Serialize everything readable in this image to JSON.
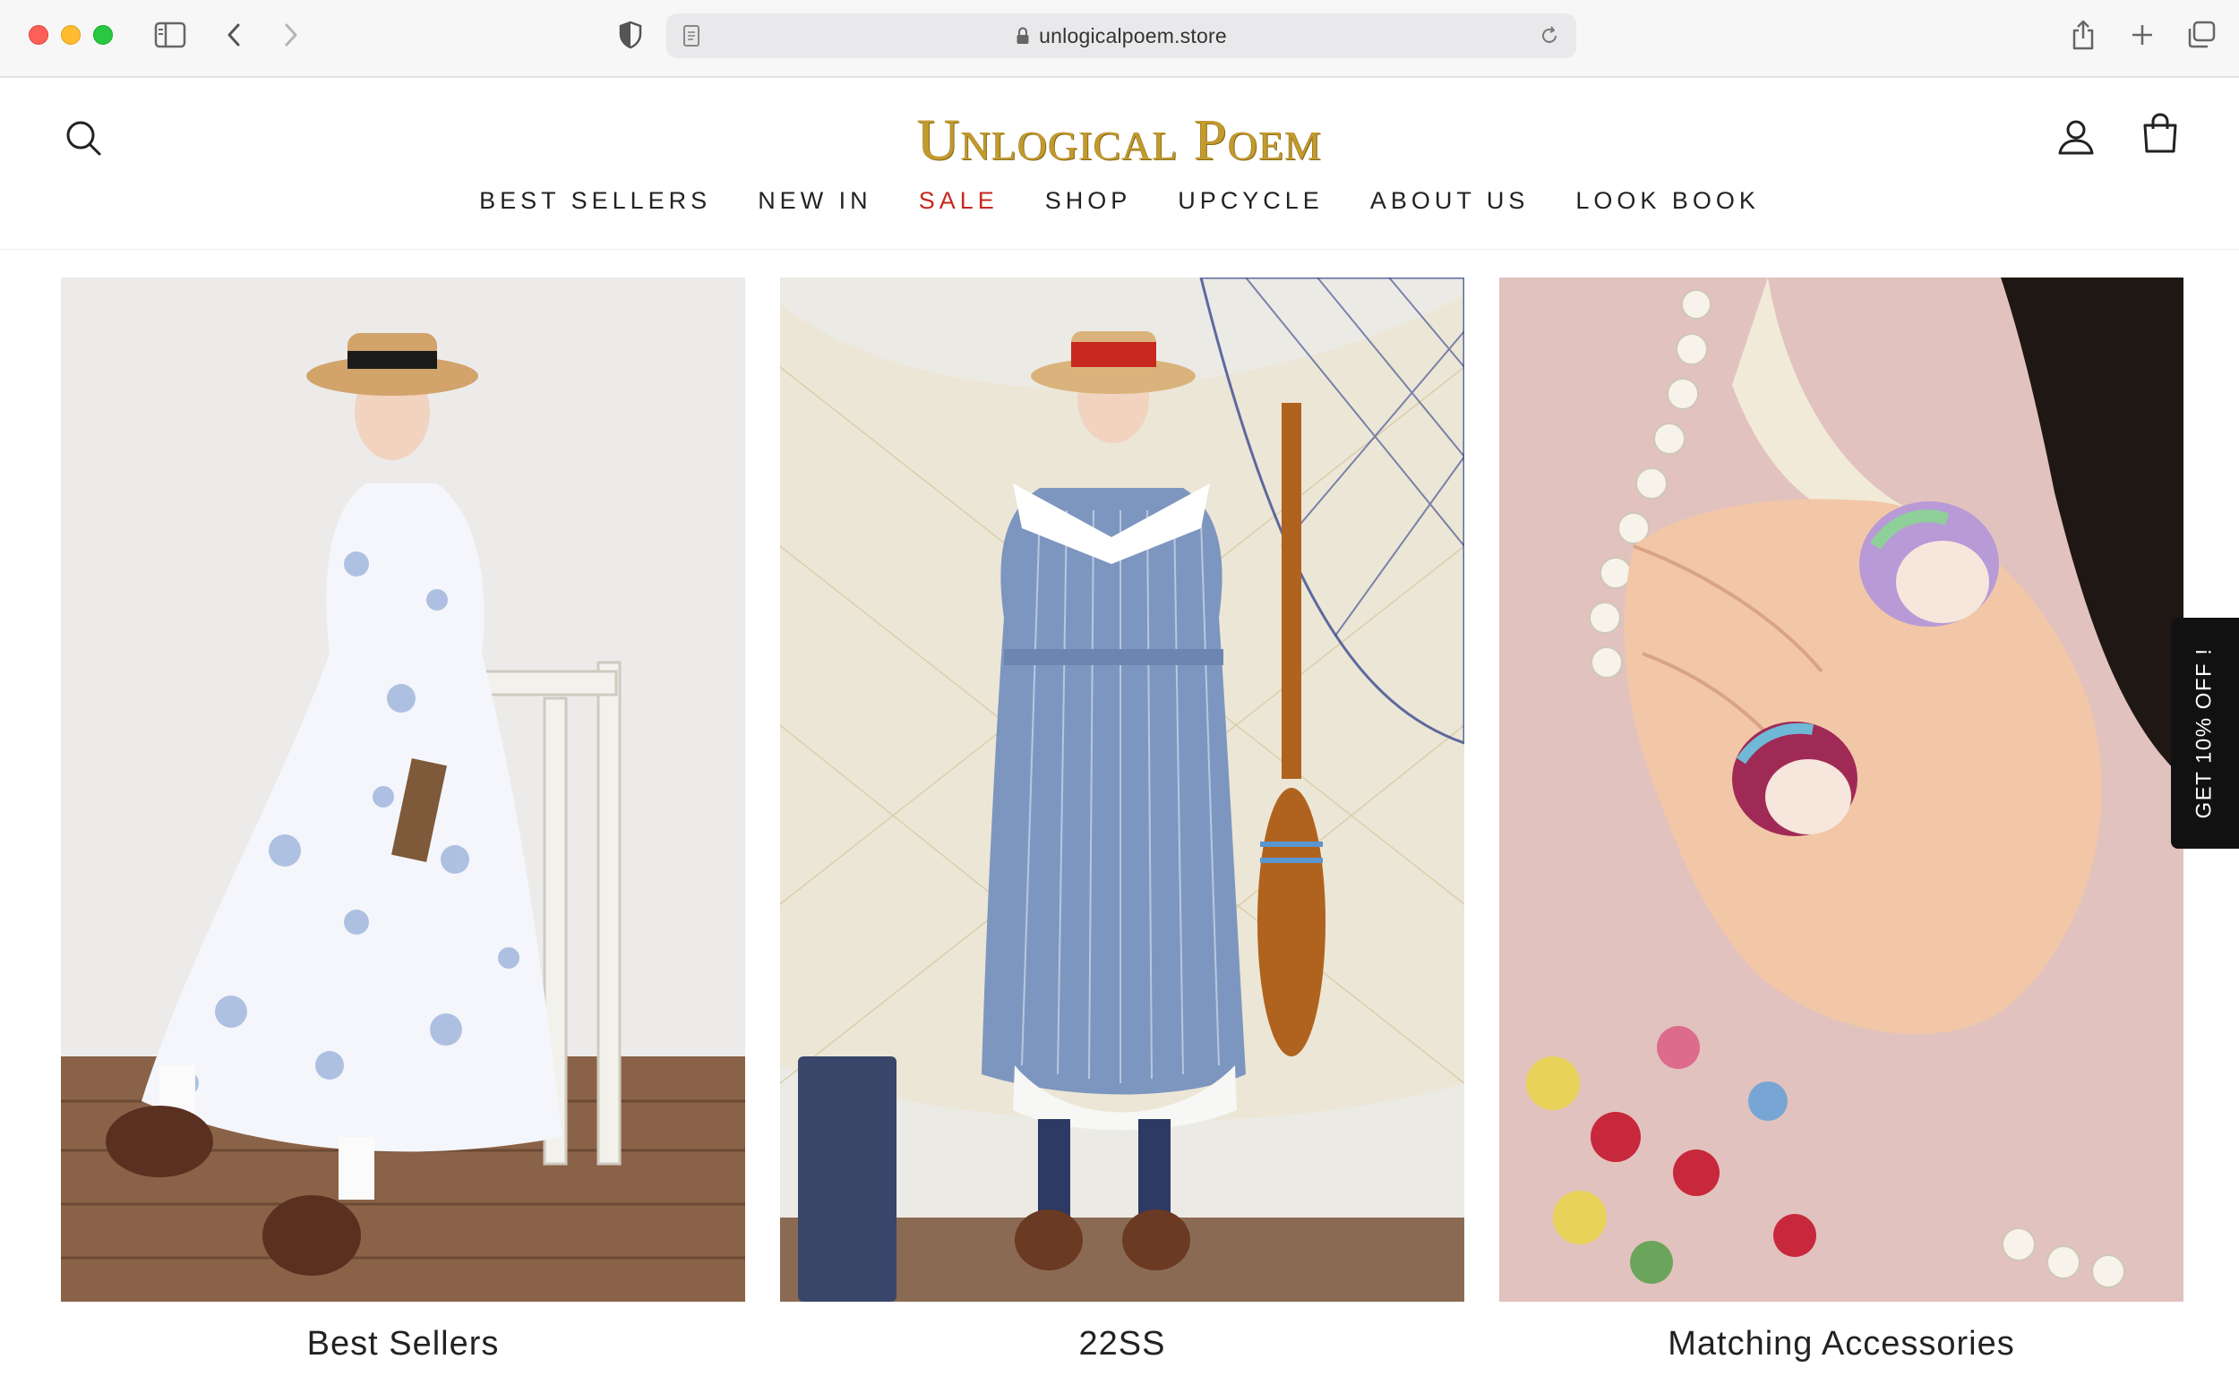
{
  "browser": {
    "url": "unlogicalpoem.store",
    "icons": [
      "sidebar-icon",
      "chevron-left-icon",
      "chevron-right-icon",
      "shield-icon",
      "page-icon",
      "lock-icon",
      "reload-icon",
      "share-icon",
      "plus-icon",
      "tabs-icon"
    ]
  },
  "header": {
    "logo_text": "Unlogical Poem",
    "nav": [
      {
        "label": "BEST SELLERS"
      },
      {
        "label": "NEW IN"
      },
      {
        "label": "SALE"
      },
      {
        "label": "SHOP"
      },
      {
        "label": "UPCYCLE"
      },
      {
        "label": "ABOUT US"
      },
      {
        "label": "LOOK BOOK"
      }
    ],
    "sale_color": "#c8281e",
    "logo_color": "#c39a2c"
  },
  "collections": [
    {
      "title": "Best Sellers"
    },
    {
      "title": "22SS"
    },
    {
      "title": "Matching Accessories"
    }
  ],
  "promo": {
    "label": "GET 10% OFF !"
  }
}
